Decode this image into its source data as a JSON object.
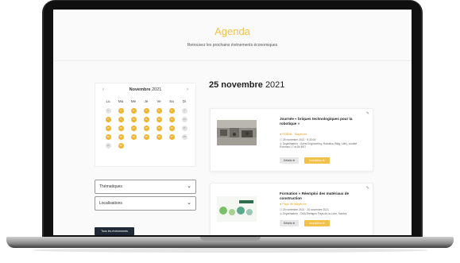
{
  "page": {
    "title": "Agenda",
    "subtitle": "Retrouvez les prochains événements économiques"
  },
  "calendar": {
    "prev": "‹",
    "next": "›",
    "month": "Novembre",
    "year": "2021",
    "day_names": [
      "Lu",
      "Ma",
      "Me",
      "Je",
      "Ve",
      "Sa",
      "Di"
    ],
    "days": [
      {
        "n": "1",
        "ev": false
      },
      {
        "n": "2",
        "ev": true
      },
      {
        "n": "3",
        "ev": true
      },
      {
        "n": "4",
        "ev": true
      },
      {
        "n": "5",
        "ev": true
      },
      {
        "n": "6",
        "ev": true
      },
      {
        "n": "7",
        "ev": false
      },
      {
        "n": "8",
        "ev": true
      },
      {
        "n": "9",
        "ev": true
      },
      {
        "n": "10",
        "ev": true
      },
      {
        "n": "11",
        "ev": true
      },
      {
        "n": "12",
        "ev": true
      },
      {
        "n": "13",
        "ev": true
      },
      {
        "n": "14",
        "ev": false
      },
      {
        "n": "15",
        "ev": true
      },
      {
        "n": "16",
        "ev": true
      },
      {
        "n": "17",
        "ev": true
      },
      {
        "n": "18",
        "ev": true
      },
      {
        "n": "19",
        "ev": true
      },
      {
        "n": "20",
        "ev": true
      },
      {
        "n": "21",
        "ev": false
      },
      {
        "n": "22",
        "ev": true
      },
      {
        "n": "23",
        "ev": true
      },
      {
        "n": "24",
        "ev": true
      },
      {
        "n": "25",
        "ev": true
      },
      {
        "n": "26",
        "ev": true
      },
      {
        "n": "27",
        "ev": true
      },
      {
        "n": "28",
        "ev": false
      },
      {
        "n": "29",
        "ev": false
      },
      {
        "n": "30",
        "ev": true
      }
    ]
  },
  "filters": {
    "thematiques": "Thématiques",
    "localisations": "Localisations",
    "all_events": "Tous les événements"
  },
  "selected_date": {
    "day_month": "25 novembre",
    "year": "2021"
  },
  "events": [
    {
      "title": "Journée « briques technologiques pour la robotique »",
      "category": "● ROBIN - Mayenne",
      "date_line": "☐ 25 novembre 2021 · 9:30:00",
      "organizer": "◎ Organisateur : Ouest Engineering, Robotics (Bldg, Lille), société Pommes 17 et 8h BST",
      "details": "Détails ⊕",
      "register": "Inscription ⊕"
    },
    {
      "title": "Formation « Réemploi des matériaux de construction",
      "category": "● Pays de Mayenne",
      "date_line": "☐ 25 novembre 2021 · 26 novembre 2021",
      "organizer": "◎ Organisateur : CMA Bretagne Pays-de-la-Loire, Nantes",
      "details": "Détails ⊕",
      "register": "Inscription ⊕"
    }
  ],
  "colors": {
    "accent": "#f2c14a",
    "event_day": "#f2b531",
    "dark_button": "#1f2a36"
  }
}
